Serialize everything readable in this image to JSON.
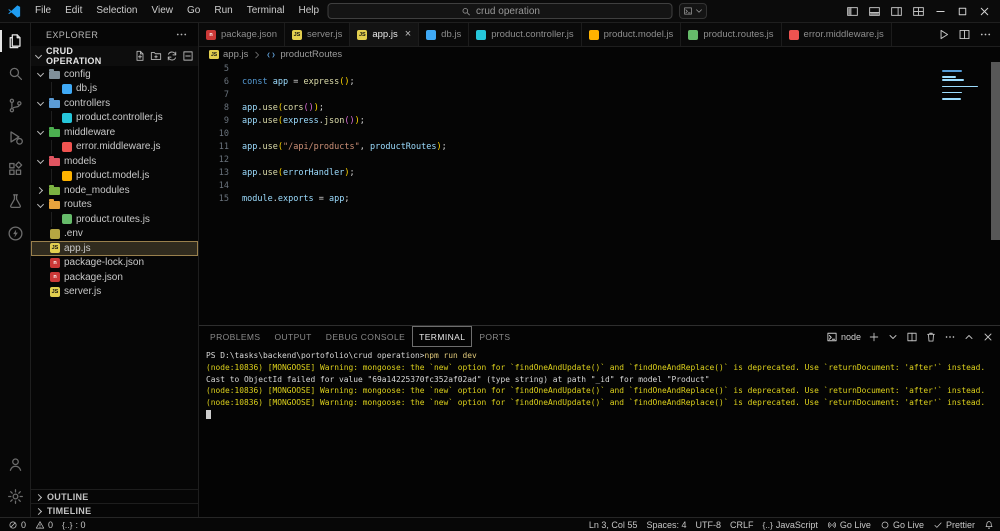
{
  "titlebar": {
    "search": "crud operation",
    "menus": [
      "File",
      "Edit",
      "Selection",
      "View",
      "Go",
      "Run",
      "Terminal",
      "Help"
    ]
  },
  "activity_bar": {
    "top": [
      {
        "id": "explorer",
        "icon": "files",
        "active": true
      },
      {
        "id": "search",
        "icon": "search",
        "active": false
      },
      {
        "id": "source-control",
        "icon": "scm",
        "active": false
      },
      {
        "id": "run-debug",
        "icon": "debug",
        "active": false
      },
      {
        "id": "extensions",
        "icon": "ext",
        "active": false
      },
      {
        "id": "testing",
        "icon": "flask",
        "active": false
      },
      {
        "id": "thunder-client",
        "icon": "thunder",
        "active": false
      }
    ],
    "bottom": [
      {
        "id": "account",
        "icon": "account"
      },
      {
        "id": "settings",
        "icon": "gear"
      }
    ]
  },
  "explorer": {
    "title": "EXPLORER",
    "project": "CRUD OPERATION",
    "outline_label": "OUTLINE",
    "timeline_label": "TIMELINE",
    "tree": [
      {
        "label": "config",
        "kind": "folder",
        "depth": 0,
        "open": true,
        "color": "#80909a"
      },
      {
        "label": "db.js",
        "kind": "db",
        "depth": 1
      },
      {
        "label": "controllers",
        "kind": "folder",
        "depth": 0,
        "open": true,
        "color": "#5b9bd5"
      },
      {
        "label": "product.controller.js",
        "kind": "controller",
        "depth": 1
      },
      {
        "label": "middleware",
        "kind": "folder",
        "depth": 0,
        "open": true,
        "color": "#4caf50"
      },
      {
        "label": "error.middleware.js",
        "kind": "middleware",
        "depth": 1
      },
      {
        "label": "models",
        "kind": "folder",
        "depth": 0,
        "open": true,
        "color": "#e05561"
      },
      {
        "label": "product.model.js",
        "kind": "model",
        "depth": 1
      },
      {
        "label": "node_modules",
        "kind": "folder",
        "depth": 0,
        "open": false,
        "color": "#7cb342"
      },
      {
        "label": "routes",
        "kind": "folder",
        "depth": 0,
        "open": true,
        "color": "#e8a33d"
      },
      {
        "label": "product.routes.js",
        "kind": "routes",
        "depth": 1
      },
      {
        "label": ".env",
        "kind": "env",
        "depth": 0
      },
      {
        "label": "app.js",
        "kind": "js",
        "depth": 0,
        "selected": true
      },
      {
        "label": "package-lock.json",
        "kind": "npm",
        "depth": 0
      },
      {
        "label": "package.json",
        "kind": "npm",
        "depth": 0
      },
      {
        "label": "server.js",
        "kind": "js",
        "depth": 0
      }
    ]
  },
  "tabs": [
    {
      "label": "package.json",
      "kind": "npm",
      "active": false
    },
    {
      "label": "server.js",
      "kind": "js",
      "active": false
    },
    {
      "label": "app.js",
      "kind": "js",
      "active": true
    },
    {
      "label": "db.js",
      "kind": "db",
      "active": false
    },
    {
      "label": "product.controller.js",
      "kind": "controller",
      "active": false
    },
    {
      "label": "product.model.js",
      "kind": "model",
      "active": false
    },
    {
      "label": "product.routes.js",
      "kind": "routes",
      "active": false
    },
    {
      "label": "error.middleware.js",
      "kind": "middleware",
      "active": false
    }
  ],
  "breadcrumb": {
    "file": "app.js",
    "symbol": "productRoutes"
  },
  "code": {
    "lines": [
      {
        "n": 5,
        "t": []
      },
      {
        "n": 6,
        "t": [
          [
            "const",
            "kw"
          ],
          [
            " ",
            "pl"
          ],
          [
            "app",
            "vr"
          ],
          [
            " ",
            "pl"
          ],
          [
            "=",
            "pl"
          ],
          [
            " ",
            "pl"
          ],
          [
            "express",
            "fn"
          ],
          [
            "(",
            "b1"
          ],
          [
            ")",
            "b1"
          ],
          [
            ";",
            "pl"
          ]
        ]
      },
      {
        "n": 7,
        "t": []
      },
      {
        "n": 8,
        "t": [
          [
            "app",
            "vr"
          ],
          [
            ".",
            "pl"
          ],
          [
            "use",
            "fn"
          ],
          [
            "(",
            "b1"
          ],
          [
            "cors",
            "fn"
          ],
          [
            "(",
            "b2"
          ],
          [
            ")",
            "b2"
          ],
          [
            ")",
            "b1"
          ],
          [
            ";",
            "pl"
          ]
        ]
      },
      {
        "n": 9,
        "t": [
          [
            "app",
            "vr"
          ],
          [
            ".",
            "pl"
          ],
          [
            "use",
            "fn"
          ],
          [
            "(",
            "b1"
          ],
          [
            "express",
            "vr"
          ],
          [
            ".",
            "pl"
          ],
          [
            "json",
            "fn"
          ],
          [
            "(",
            "b2"
          ],
          [
            ")",
            "b2"
          ],
          [
            ")",
            "b1"
          ],
          [
            ";",
            "pl"
          ]
        ]
      },
      {
        "n": 10,
        "t": []
      },
      {
        "n": 11,
        "t": [
          [
            "app",
            "vr"
          ],
          [
            ".",
            "pl"
          ],
          [
            "use",
            "fn"
          ],
          [
            "(",
            "b1"
          ],
          [
            "\"/api/products\"",
            "st"
          ],
          [
            ",",
            "pl"
          ],
          [
            " ",
            "pl"
          ],
          [
            "productRoutes",
            "vr"
          ],
          [
            ")",
            "b1"
          ],
          [
            ";",
            "pl"
          ]
        ]
      },
      {
        "n": 12,
        "t": []
      },
      {
        "n": 13,
        "t": [
          [
            "app",
            "vr"
          ],
          [
            ".",
            "pl"
          ],
          [
            "use",
            "fn"
          ],
          [
            "(",
            "b1"
          ],
          [
            "errorHandler",
            "vr"
          ],
          [
            ")",
            "b1"
          ],
          [
            ";",
            "pl"
          ]
        ]
      },
      {
        "n": 14,
        "t": []
      },
      {
        "n": 15,
        "t": [
          [
            "module",
            "vr"
          ],
          [
            ".",
            "pl"
          ],
          [
            "exports",
            "vr"
          ],
          [
            " ",
            "pl"
          ],
          [
            "=",
            "pl"
          ],
          [
            " ",
            "pl"
          ],
          [
            "app",
            "vr"
          ],
          [
            ";",
            "pl"
          ]
        ]
      }
    ]
  },
  "panel": {
    "tabs": [
      "PROBLEMS",
      "OUTPUT",
      "DEBUG CONSOLE",
      "TERMINAL",
      "PORTS"
    ],
    "active_tab": "TERMINAL",
    "profile": "node"
  },
  "terminal": {
    "cursor": true,
    "lines": [
      [
        [
          "PS D:\\tasks\\backend\\portofolio\\crud operation>",
          "wh"
        ],
        [
          "npm run dev",
          "cmd"
        ]
      ],
      [
        [
          "(node:10836) [MONGOOSE] Warning: mongoose: the `new` option for `findOneAndUpdate()` and `findOneAndReplace()` is deprecated. Use `returnDocument: 'after'` instead.",
          "yl"
        ]
      ],
      [
        [
          "Cast to ObjectId failed for value \"69a14225370fc352af02ad\" (type string) at path \"_id\" for model \"Product\"",
          "wh"
        ]
      ],
      [
        [
          "(node:10836) [MONGOOSE] Warning: mongoose: the `new` option for `findOneAndUpdate()` and `findOneAndReplace()` is deprecated. Use `returnDocument: 'after'` instead.",
          "yl"
        ]
      ],
      [
        [
          "(node:10836) [MONGOOSE] Warning: mongoose: the `new` option for `findOneAndUpdate()` and `findOneAndReplace()` is deprecated. Use `returnDocument: 'after'` instead.",
          "yl"
        ]
      ]
    ]
  },
  "statusbar": {
    "left": [
      {
        "id": "errors",
        "icon": "err",
        "text": "0"
      },
      {
        "id": "warnings",
        "icon": "warn",
        "text": "0"
      },
      {
        "id": "count",
        "icon": "braces",
        "text": ": 0"
      }
    ],
    "right": [
      {
        "id": "cursor-position",
        "text": "Ln 3, Col 55"
      },
      {
        "id": "indentation",
        "text": "Spaces: 4"
      },
      {
        "id": "encoding",
        "text": "UTF-8"
      },
      {
        "id": "eol",
        "text": "CRLF"
      },
      {
        "id": "language",
        "icon": "braces",
        "text": "JavaScript"
      },
      {
        "id": "go-live-port",
        "icon": "bcast",
        "text": "Go Live"
      },
      {
        "id": "go-live",
        "icon": "circ",
        "text": "Go Live"
      },
      {
        "id": "prettier",
        "icon": "check",
        "text": "Prettier"
      },
      {
        "id": "notifications",
        "icon": "bell",
        "text": ""
      }
    ]
  }
}
